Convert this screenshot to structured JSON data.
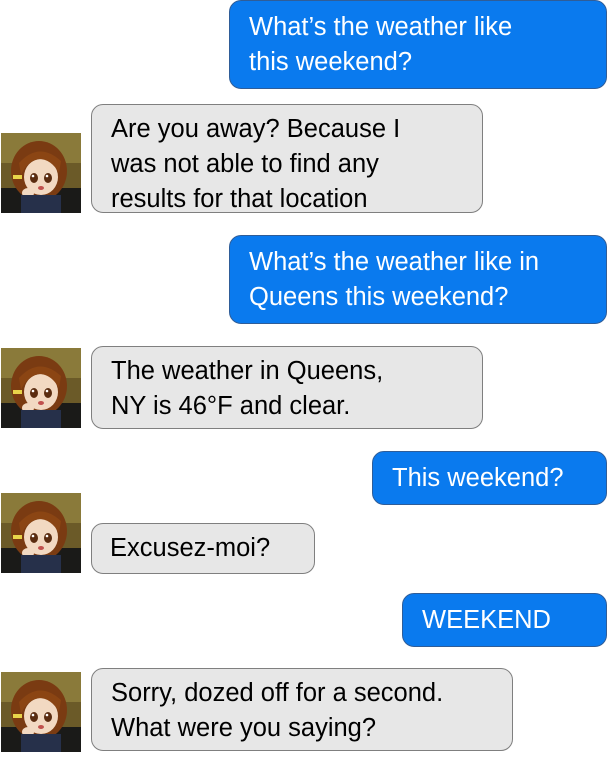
{
  "conversation": {
    "messages": [
      {
        "sender": "user",
        "lines": [
          "What’s the weather like",
          "this weekend?"
        ]
      },
      {
        "sender": "bot",
        "lines": [
          "Are you away? Because I",
          "was not able to find any",
          "results for that location"
        ]
      },
      {
        "sender": "user",
        "lines": [
          "What’s the weather like in",
          "Queens this weekend?"
        ]
      },
      {
        "sender": "bot",
        "lines": [
          "The weather in Queens,",
          "NY is 46°F and clear."
        ]
      },
      {
        "sender": "user",
        "lines": [
          "This weekend?"
        ]
      },
      {
        "sender": "bot",
        "lines": [
          "Excusez-moi?"
        ]
      },
      {
        "sender": "user",
        "lines": [
          "WEEKEND"
        ]
      },
      {
        "sender": "bot",
        "lines": [
          "Sorry, dozed off for a second.",
          "What were you saying?"
        ]
      }
    ]
  },
  "avatar": {
    "icon": "anime-figure-avatar-icon"
  },
  "colors": {
    "user_bubble": "#0a7aee",
    "user_border": "#2f5d98",
    "bot_bubble": "#e7e7e7",
    "bot_border": "#7f7f7f"
  }
}
